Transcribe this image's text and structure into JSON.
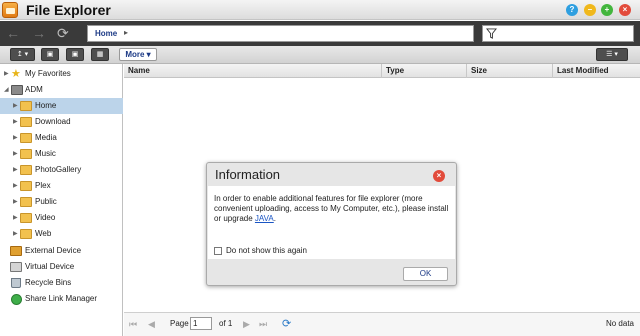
{
  "window": {
    "title": "File Explorer"
  },
  "navbar": {
    "path_home": "Home",
    "filter_placeholder": ""
  },
  "toolbar": {
    "more_label": "More"
  },
  "sidebar": {
    "my_favorites": "My Favorites",
    "adm": "ADM",
    "folders": [
      "Home",
      "Download",
      "Media",
      "Music",
      "PhotoGallery",
      "Plex",
      "Public",
      "Video",
      "Web"
    ],
    "selected_folder": "Home",
    "external_device": "External Device",
    "virtual_device": "Virtual Device",
    "recycle_bins": "Recycle Bins",
    "share_link_manager": "Share Link Manager"
  },
  "table": {
    "columns": [
      "Name",
      "Type",
      "Size",
      "Last Modified"
    ]
  },
  "pager": {
    "page_label": "Page",
    "page_value": "1",
    "of_label": "of 1",
    "status": "No data"
  },
  "dialog": {
    "title": "Information",
    "message_pre": "In order to enable additional features for file explorer (more convenient uploading, access to My Computer, etc.), please install or upgrade ",
    "message_link": "JAVA",
    "message_post": ".",
    "checkbox_label": "Do not show this again",
    "ok_label": "OK"
  },
  "colors": {
    "accent": "#1c3a86",
    "selected": "#bcd4ea",
    "navbar": "#3a3a3a",
    "close": "#e24b3b"
  }
}
